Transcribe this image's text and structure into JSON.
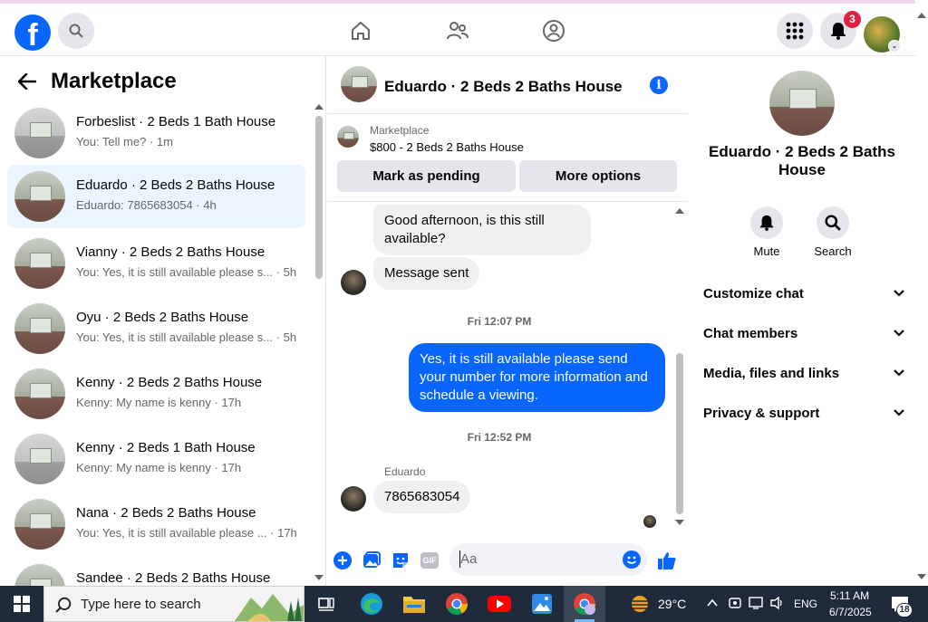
{
  "topbar": {
    "logo_letter": "f",
    "notification_count": "3"
  },
  "left": {
    "title": "Marketplace",
    "conversations": [
      {
        "name": "Forbeslist · 2 Beds 1 Bath House",
        "snippet": "You: Tell me? · 1m",
        "thumb": "grey"
      },
      {
        "name": "Eduardo · 2 Beds 2 Baths House",
        "snippet": "Eduardo: 7865683054 · 4h",
        "thumb": "room"
      },
      {
        "name": "Vianny · 2 Beds 2 Baths House",
        "snippet": "You: Yes, it is still available please s... · 5h",
        "thumb": "room"
      },
      {
        "name": "Oyu · 2 Beds 2 Baths House",
        "snippet": "You: Yes, it is still available please s... · 5h",
        "thumb": "room"
      },
      {
        "name": "Kenny · 2 Beds 2 Baths House",
        "snippet": "Kenny: My name is kenny · 17h",
        "thumb": "room"
      },
      {
        "name": "Kenny · 2 Beds 1 Bath House",
        "snippet": "Kenny: My name is kenny · 17h",
        "thumb": "grey"
      },
      {
        "name": "Nana · 2 Beds 2 Baths House",
        "snippet": "You: Yes, it is still available please ... · 17h",
        "thumb": "room"
      },
      {
        "name": "Sandee · 2 Beds 2 Baths House",
        "snippet": "",
        "thumb": "room"
      }
    ]
  },
  "chat": {
    "title": "Eduardo · 2 Beds 2 Baths House",
    "marketplace_label": "Marketplace",
    "listing": "$800 - 2 Beds 2 Baths House",
    "mark_pending": "Mark as pending",
    "more_options": "More options",
    "msg_in_1": "Good afternoon, is this still available?",
    "msg_in_2": "Message sent",
    "time_1": "Fri 12:07 PM",
    "msg_out_1": "Yes, it is still available please send your number for more information and schedule a viewing.",
    "time_2": "Fri 12:52 PM",
    "sender_name": "Eduardo",
    "msg_in_3": "7865683054",
    "composer_placeholder": "Aa",
    "composer_gif": "GIF"
  },
  "right": {
    "title": "Eduardo · 2 Beds 2 Baths House",
    "mute": "Mute",
    "search": "Search",
    "rows": [
      "Customize chat",
      "Chat members",
      "Media, files and links",
      "Privacy & support"
    ]
  },
  "taskbar": {
    "search_placeholder": "Type here to search",
    "temperature": "29°C",
    "language": "ENG",
    "time": "5:11 AM",
    "date": "6/7/2025",
    "notification_count": "18"
  }
}
